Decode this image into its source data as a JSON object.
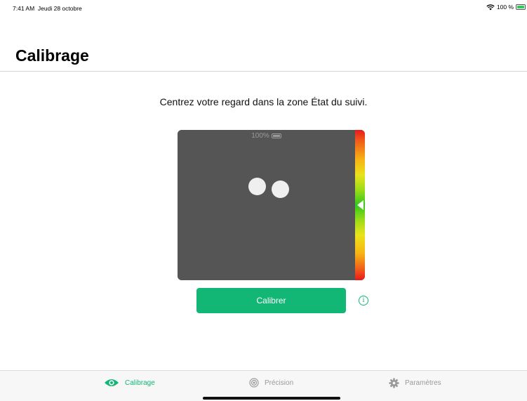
{
  "status_bar": {
    "time": "7:41 AM",
    "date": "Jeudi 28 octobre",
    "battery": "100 %",
    "wifi_icon": "wifi-icon",
    "battery_icon": "battery-charging-icon"
  },
  "page": {
    "title": "Calibrage",
    "instruction": "Centrez votre regard dans la zone État du suivi."
  },
  "tracking": {
    "device_battery": "100%",
    "device_battery_icon": "battery-icon",
    "distance_level": 0.5,
    "eyes_visible": 2
  },
  "actions": {
    "calibrate_label": "Calibrer",
    "info_icon": "info-icon"
  },
  "tab_bar": {
    "items": [
      {
        "label": "Calibrage",
        "icon": "eye-icon",
        "active": true
      },
      {
        "label": "Précision",
        "icon": "target-icon",
        "active": false
      },
      {
        "label": "Paramètres",
        "icon": "gear-icon",
        "active": false
      }
    ]
  },
  "colors": {
    "accent": "#12b775",
    "tracking_background": "#555555",
    "inactive": "#9a9a9a"
  }
}
